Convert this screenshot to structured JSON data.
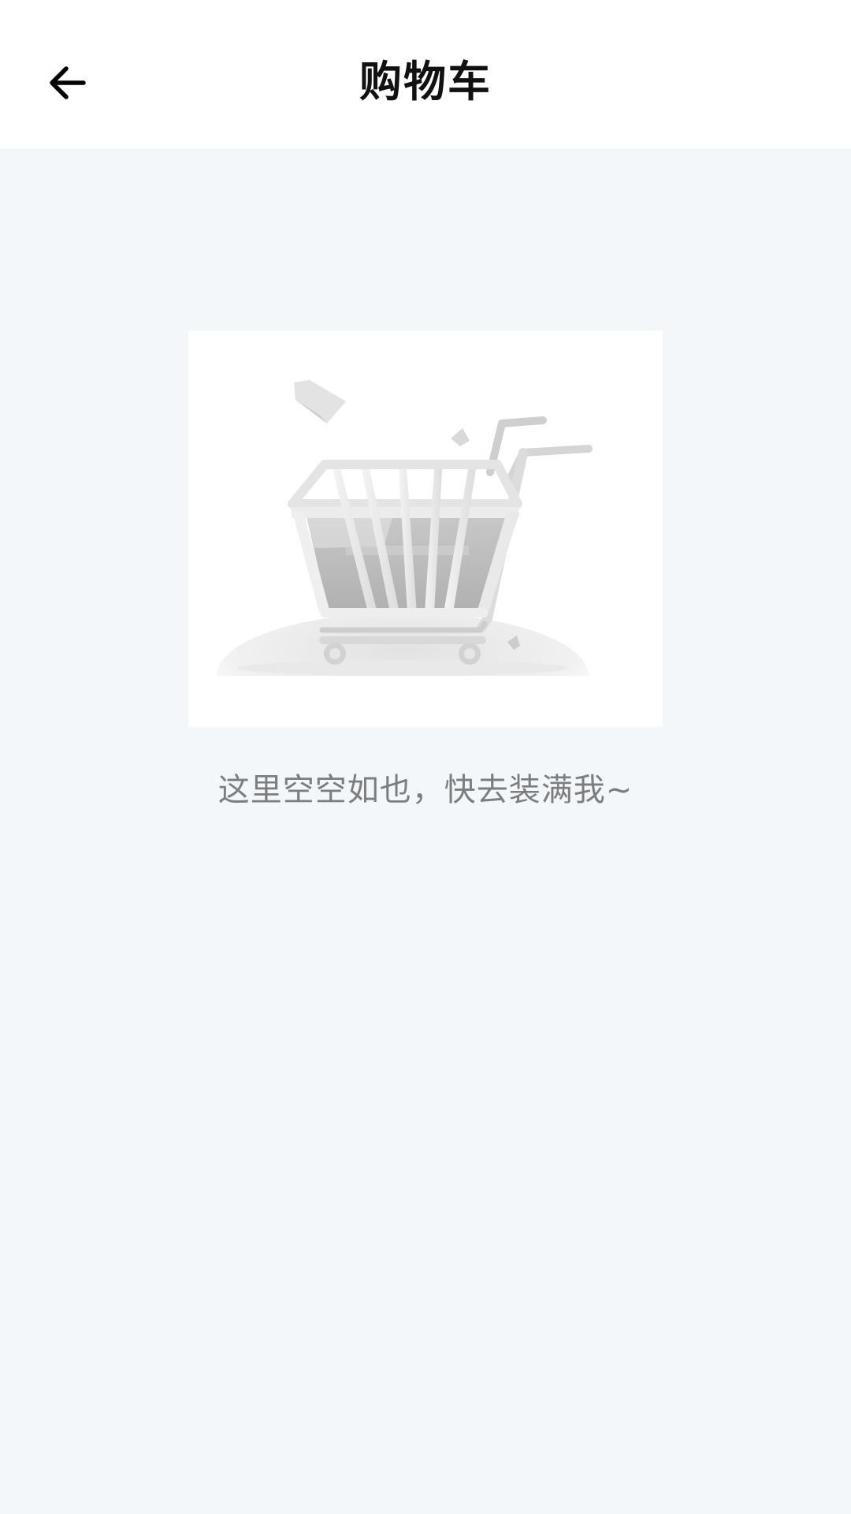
{
  "header": {
    "back_icon": "arrow-left-icon",
    "title": "购物车"
  },
  "empty_state": {
    "illustration_icon": "shopping-cart-icon",
    "message": "这里空空如也，快去装满我~"
  },
  "colors": {
    "background": "#f3f7fa",
    "header_background": "#ffffff",
    "title_text": "#111111",
    "message_text": "#7d7d7d"
  }
}
